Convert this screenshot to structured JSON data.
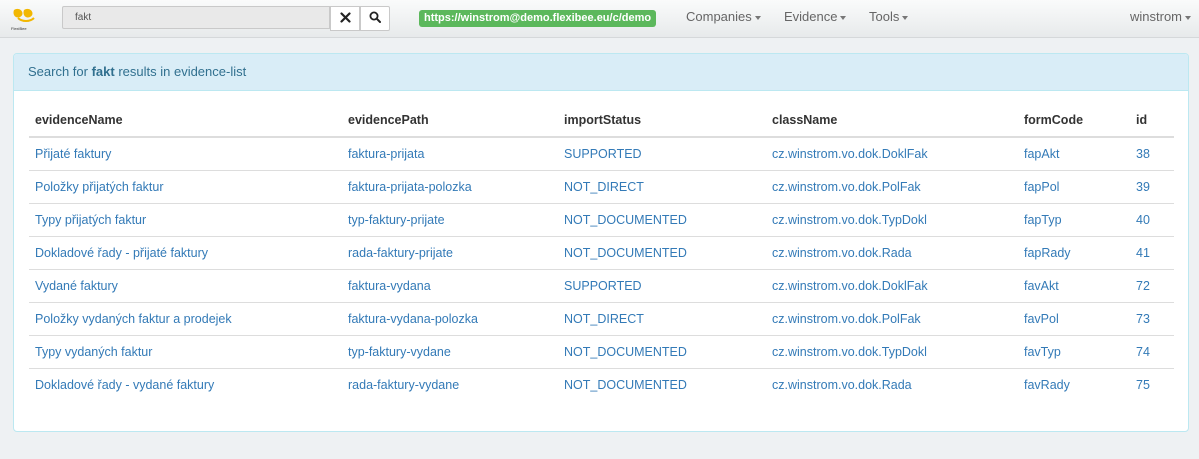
{
  "navbar": {
    "logo_text": "FlexiBee",
    "search_value": "fakt",
    "url": "https://winstrom@demo.flexibee.eu/c/demo",
    "menus": [
      "Companies",
      "Evidence",
      "Tools"
    ],
    "user": "winstrom"
  },
  "panel": {
    "prefix": "Search for ",
    "query": "fakt",
    "suffix": " results in evidence-list"
  },
  "table": {
    "headers": [
      "evidenceName",
      "evidencePath",
      "importStatus",
      "className",
      "formCode",
      "id"
    ],
    "rows": [
      [
        "Přijaté faktury",
        "faktura-prijata",
        "SUPPORTED",
        "cz.winstrom.vo.dok.DoklFak",
        "fapAkt",
        "38"
      ],
      [
        "Položky přijatých faktur",
        "faktura-prijata-polozka",
        "NOT_DIRECT",
        "cz.winstrom.vo.dok.PolFak",
        "fapPol",
        "39"
      ],
      [
        "Typy přijatých faktur",
        "typ-faktury-prijate",
        "NOT_DOCUMENTED",
        "cz.winstrom.vo.dok.TypDokl",
        "fapTyp",
        "40"
      ],
      [
        "Dokladové řady - přijaté faktury",
        "rada-faktury-prijate",
        "NOT_DOCUMENTED",
        "cz.winstrom.vo.dok.Rada",
        "fapRady",
        "41"
      ],
      [
        "Vydané faktury",
        "faktura-vydana",
        "SUPPORTED",
        "cz.winstrom.vo.dok.DoklFak",
        "favAkt",
        "72"
      ],
      [
        "Položky vydaných faktur a prodejek",
        "faktura-vydana-polozka",
        "NOT_DIRECT",
        "cz.winstrom.vo.dok.PolFak",
        "favPol",
        "73"
      ],
      [
        "Typy vydaných faktur",
        "typ-faktury-vydane",
        "NOT_DOCUMENTED",
        "cz.winstrom.vo.dok.TypDokl",
        "favTyp",
        "74"
      ],
      [
        "Dokladové řady - vydané faktury",
        "rada-faktury-vydane",
        "NOT_DOCUMENTED",
        "cz.winstrom.vo.dok.Rada",
        "favRady",
        "75"
      ]
    ]
  },
  "colors": {
    "accent": "#337ab7",
    "url_badge": "#5cb85c",
    "panel_heading_bg": "#d9edf7",
    "logo_yellow": "#f2b700"
  },
  "icons": {
    "clear": "close-icon",
    "search": "search-icon",
    "logo": "flexibee-logo"
  }
}
